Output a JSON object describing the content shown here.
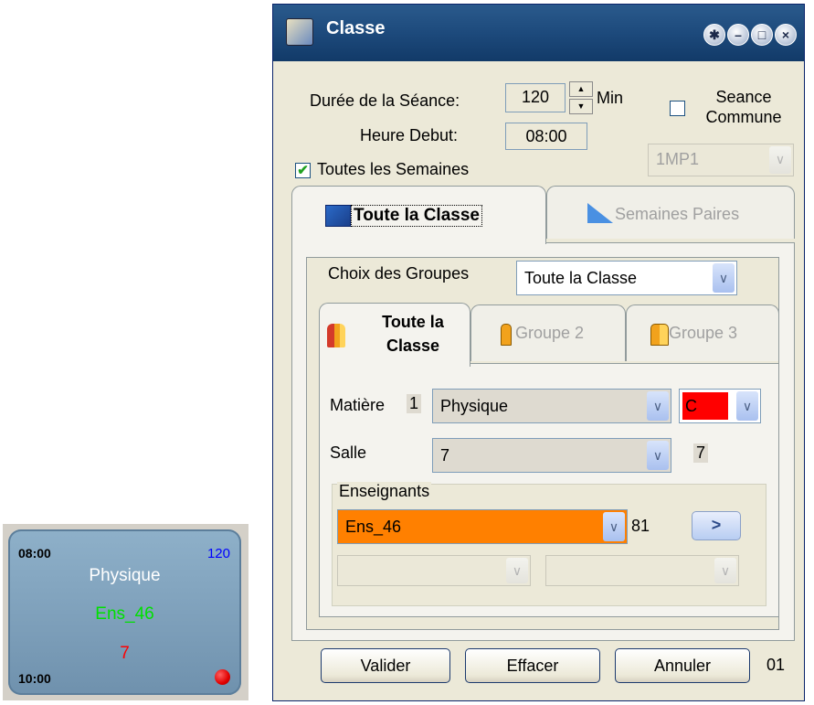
{
  "card": {
    "start_time": "08:00",
    "duration": "120",
    "subject": "Physique",
    "teacher": "Ens_46",
    "room": "7",
    "end_time": "10:00",
    "indicator": "red-dot"
  },
  "window": {
    "title": "Classe",
    "title_buttons": [
      "help",
      "minimize",
      "maximize",
      "close"
    ]
  },
  "form": {
    "duree_label": "Durée de la Séance:",
    "duree_value": "120",
    "min_label": "Min",
    "heure_label": "Heure Debut:",
    "heure_value": "08:00",
    "seance_commune_label": "Seance Commune",
    "seance_commune_checked": false,
    "toutes_semaines_label": "Toutes les Semaines",
    "toutes_semaines_checked": true,
    "week_combo_value": "1MP1"
  },
  "outer_tabs": [
    {
      "label": "Toute la Classe",
      "active": true
    },
    {
      "label": "Semaines Paires",
      "active": false
    }
  ],
  "groupes": {
    "label": "Choix des Groupes",
    "value": "Toute la Classe"
  },
  "inner_tabs": [
    {
      "label_line1": "Toute la",
      "label_line2": "Classe",
      "active": true
    },
    {
      "label": "Groupe 2",
      "active": false
    },
    {
      "label": "Groupe 3",
      "active": false
    }
  ],
  "matiere": {
    "label": "Matière",
    "number": "1",
    "value": "Physique",
    "color_code": "C",
    "color": "#ff0000"
  },
  "salle": {
    "label": "Salle",
    "value": "7",
    "number": "7"
  },
  "enseignants": {
    "legend": "Enseignants",
    "teacher": "Ens_46",
    "teacher_color": "#ff8000",
    "count": "81",
    "go_button": ">"
  },
  "footer": {
    "valider": "Valider",
    "effacer": "Effacer",
    "annuler": "Annuler",
    "code": "01"
  }
}
